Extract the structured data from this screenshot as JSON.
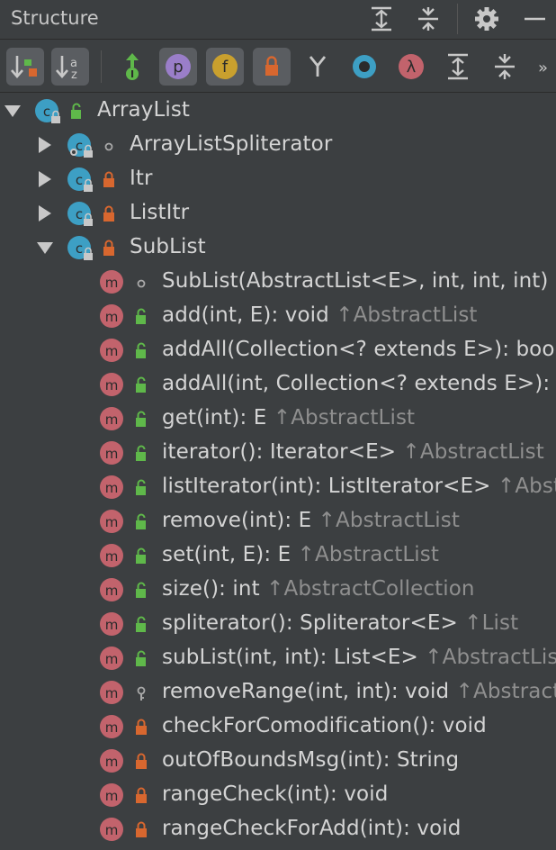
{
  "panel": {
    "title": "Structure",
    "header_icons": [
      "expand-all-icon",
      "collapse-all-icon",
      "gear-icon",
      "minimize-icon"
    ]
  },
  "toolbar": {
    "buttons": [
      {
        "name": "sort-by-visibility-button",
        "icon": "sort-visibility-icon",
        "on": true
      },
      {
        "name": "sort-alphabetically-button",
        "icon": "sort-alpha-icon",
        "on": true,
        "text": "az"
      },
      {
        "name": "show-inherited-button",
        "icon": "inherited-icon",
        "on": false,
        "text": "I"
      },
      {
        "name": "show-properties-button",
        "icon": "property-icon",
        "on": true,
        "text": "p"
      },
      {
        "name": "show-fields-button",
        "icon": "field-icon",
        "on": true,
        "text": "f"
      },
      {
        "name": "show-non-public-button",
        "icon": "lock-icon",
        "on": true
      },
      {
        "name": "filter-button",
        "icon": "filter-icon",
        "on": false
      },
      {
        "name": "show-anonymous-button",
        "icon": "anonymous-icon",
        "on": false
      },
      {
        "name": "show-lambdas-button",
        "icon": "lambda-icon",
        "on": false,
        "text": "λ"
      },
      {
        "name": "expand-button",
        "icon": "expand-icon",
        "on": false
      },
      {
        "name": "collapse-button",
        "icon": "collapse-icon",
        "on": false
      },
      {
        "name": "more-button",
        "icon": "more-icon",
        "on": false,
        "text": "»"
      }
    ]
  },
  "tree": [
    {
      "level": 0,
      "kind": "class",
      "arrow": "down",
      "vis": "public",
      "name": "ArrayList",
      "sup": ""
    },
    {
      "level": 1,
      "kind": "class-static",
      "arrow": "right",
      "vis": "package",
      "name": "ArrayListSpliterator",
      "sup": ""
    },
    {
      "level": 1,
      "kind": "class",
      "arrow": "right",
      "vis": "private",
      "name": "Itr",
      "sup": ""
    },
    {
      "level": 1,
      "kind": "class",
      "arrow": "right",
      "vis": "private",
      "name": "ListItr",
      "sup": ""
    },
    {
      "level": 1,
      "kind": "class",
      "arrow": "down",
      "vis": "private",
      "name": "SubList",
      "sup": ""
    },
    {
      "level": 2,
      "kind": "method",
      "vis": "package",
      "name": "SubList(AbstractList<E>, int, int, int)",
      "sup": ""
    },
    {
      "level": 2,
      "kind": "method",
      "vis": "public",
      "name": "add(int, E): void",
      "sup": "↑AbstractList"
    },
    {
      "level": 2,
      "kind": "method",
      "vis": "public",
      "name": "addAll(Collection<? extends E>): boolean",
      "sup": ""
    },
    {
      "level": 2,
      "kind": "method",
      "vis": "public",
      "name": "addAll(int, Collection<? extends E>): boolean",
      "sup": ""
    },
    {
      "level": 2,
      "kind": "method",
      "vis": "public",
      "name": "get(int): E",
      "sup": "↑AbstractList"
    },
    {
      "level": 2,
      "kind": "method",
      "vis": "public",
      "name": "iterator(): Iterator<E>",
      "sup": "↑AbstractList"
    },
    {
      "level": 2,
      "kind": "method",
      "vis": "public",
      "name": "listIterator(int): ListIterator<E>",
      "sup": "↑AbstractList"
    },
    {
      "level": 2,
      "kind": "method",
      "vis": "public",
      "name": "remove(int): E",
      "sup": "↑AbstractList"
    },
    {
      "level": 2,
      "kind": "method",
      "vis": "public",
      "name": "set(int, E): E",
      "sup": "↑AbstractList"
    },
    {
      "level": 2,
      "kind": "method",
      "vis": "public",
      "name": "size(): int",
      "sup": "↑AbstractCollection"
    },
    {
      "level": 2,
      "kind": "method",
      "vis": "public",
      "name": "spliterator(): Spliterator<E>",
      "sup": "↑List"
    },
    {
      "level": 2,
      "kind": "method",
      "vis": "public",
      "name": "subList(int, int): List<E>",
      "sup": "↑AbstractList"
    },
    {
      "level": 2,
      "kind": "method",
      "vis": "protected",
      "name": "removeRange(int, int): void",
      "sup": "↑AbstractList"
    },
    {
      "level": 2,
      "kind": "method",
      "vis": "private",
      "name": "checkForComodification(): void",
      "sup": ""
    },
    {
      "level": 2,
      "kind": "method",
      "vis": "private",
      "name": "outOfBoundsMsg(int): String",
      "sup": ""
    },
    {
      "level": 2,
      "kind": "method",
      "vis": "private",
      "name": "rangeCheck(int): void",
      "sup": ""
    },
    {
      "level": 2,
      "kind": "method",
      "vis": "private",
      "name": "rangeCheckForAdd(int): void",
      "sup": ""
    }
  ],
  "colors": {
    "class_icon": "#3d9fc4",
    "method_icon": "#c2636c",
    "public_lock": "#5fb84a",
    "private_lock": "#d8672f",
    "property_icon": "#9a7ec9",
    "field_icon": "#c9a02e",
    "lambda_icon": "#c2636c",
    "anonymous_icon": "#3d9fc4"
  }
}
